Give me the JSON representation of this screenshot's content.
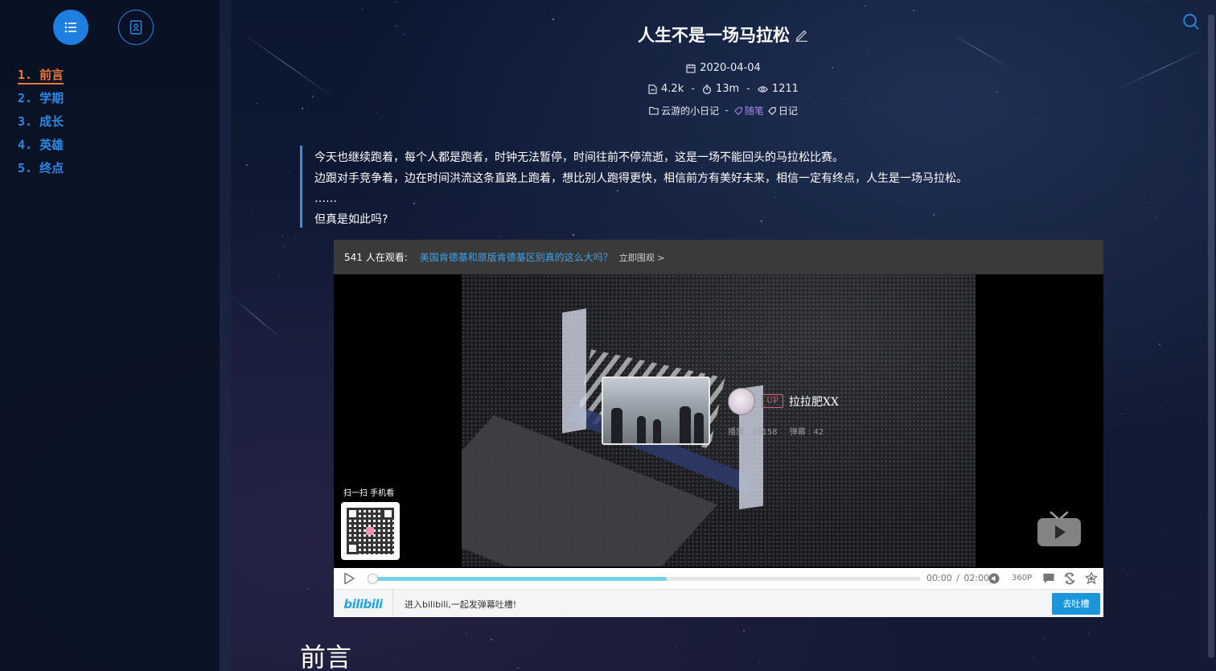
{
  "sidebar": {
    "toc": [
      {
        "number": "1.",
        "label": "前言",
        "active": true
      },
      {
        "number": "2.",
        "label": "学期",
        "active": false
      },
      {
        "number": "3.",
        "label": "成长",
        "active": false
      },
      {
        "number": "4.",
        "label": "英雄",
        "active": false
      },
      {
        "number": "5.",
        "label": "终点",
        "active": false
      }
    ]
  },
  "post": {
    "title": "人生不是一场马拉松",
    "date": "2020-04-04",
    "word_count": "4.2k",
    "read_time": "13m",
    "views": "1211",
    "category": "云游的小日记",
    "tags": [
      "随笔",
      "日记"
    ],
    "quote_lines": [
      "今天也继续跑着，每个人都是跑者，时钟无法暂停，时间往前不停流逝，这是一场不能回头的马拉松比赛。",
      "边跟对手竞争着，边在时间洪流这条直路上跑着，想比别人跑得更快，相信前方有美好未来，相信一定有终点，人生是一场马拉松。",
      "……",
      "但真是如此吗?"
    ],
    "section_heading": "前言"
  },
  "player": {
    "live_count": "541 人在观看:",
    "live_link": "美国肯德基和原版肯德基区别真的这么大吗？",
    "live_cta": "立即围观 >",
    "up_badge": "UP",
    "up_name": "拉拉肥XX",
    "plays": "播放 : 30158",
    "danmaku_count": "弹幕 : 42",
    "qr_label": "扫一扫 手机看",
    "time_current": "00:00",
    "time_sep": "/",
    "time_total": "02:00",
    "quality": "360P",
    "progress_fraction": 0,
    "buffer_fraction": 0.54,
    "brand": "bilibili",
    "danmaku_placeholder": "进入bilibili,一起发弹幕吐槽!",
    "send_label": "去吐槽"
  },
  "colors": {
    "accent_blue": "#1e7fe0",
    "toc_active": "#e87a3a",
    "toc_link": "#2b8ae6",
    "tag_purple": "#a883e8",
    "bili_blue": "#1b96db"
  }
}
